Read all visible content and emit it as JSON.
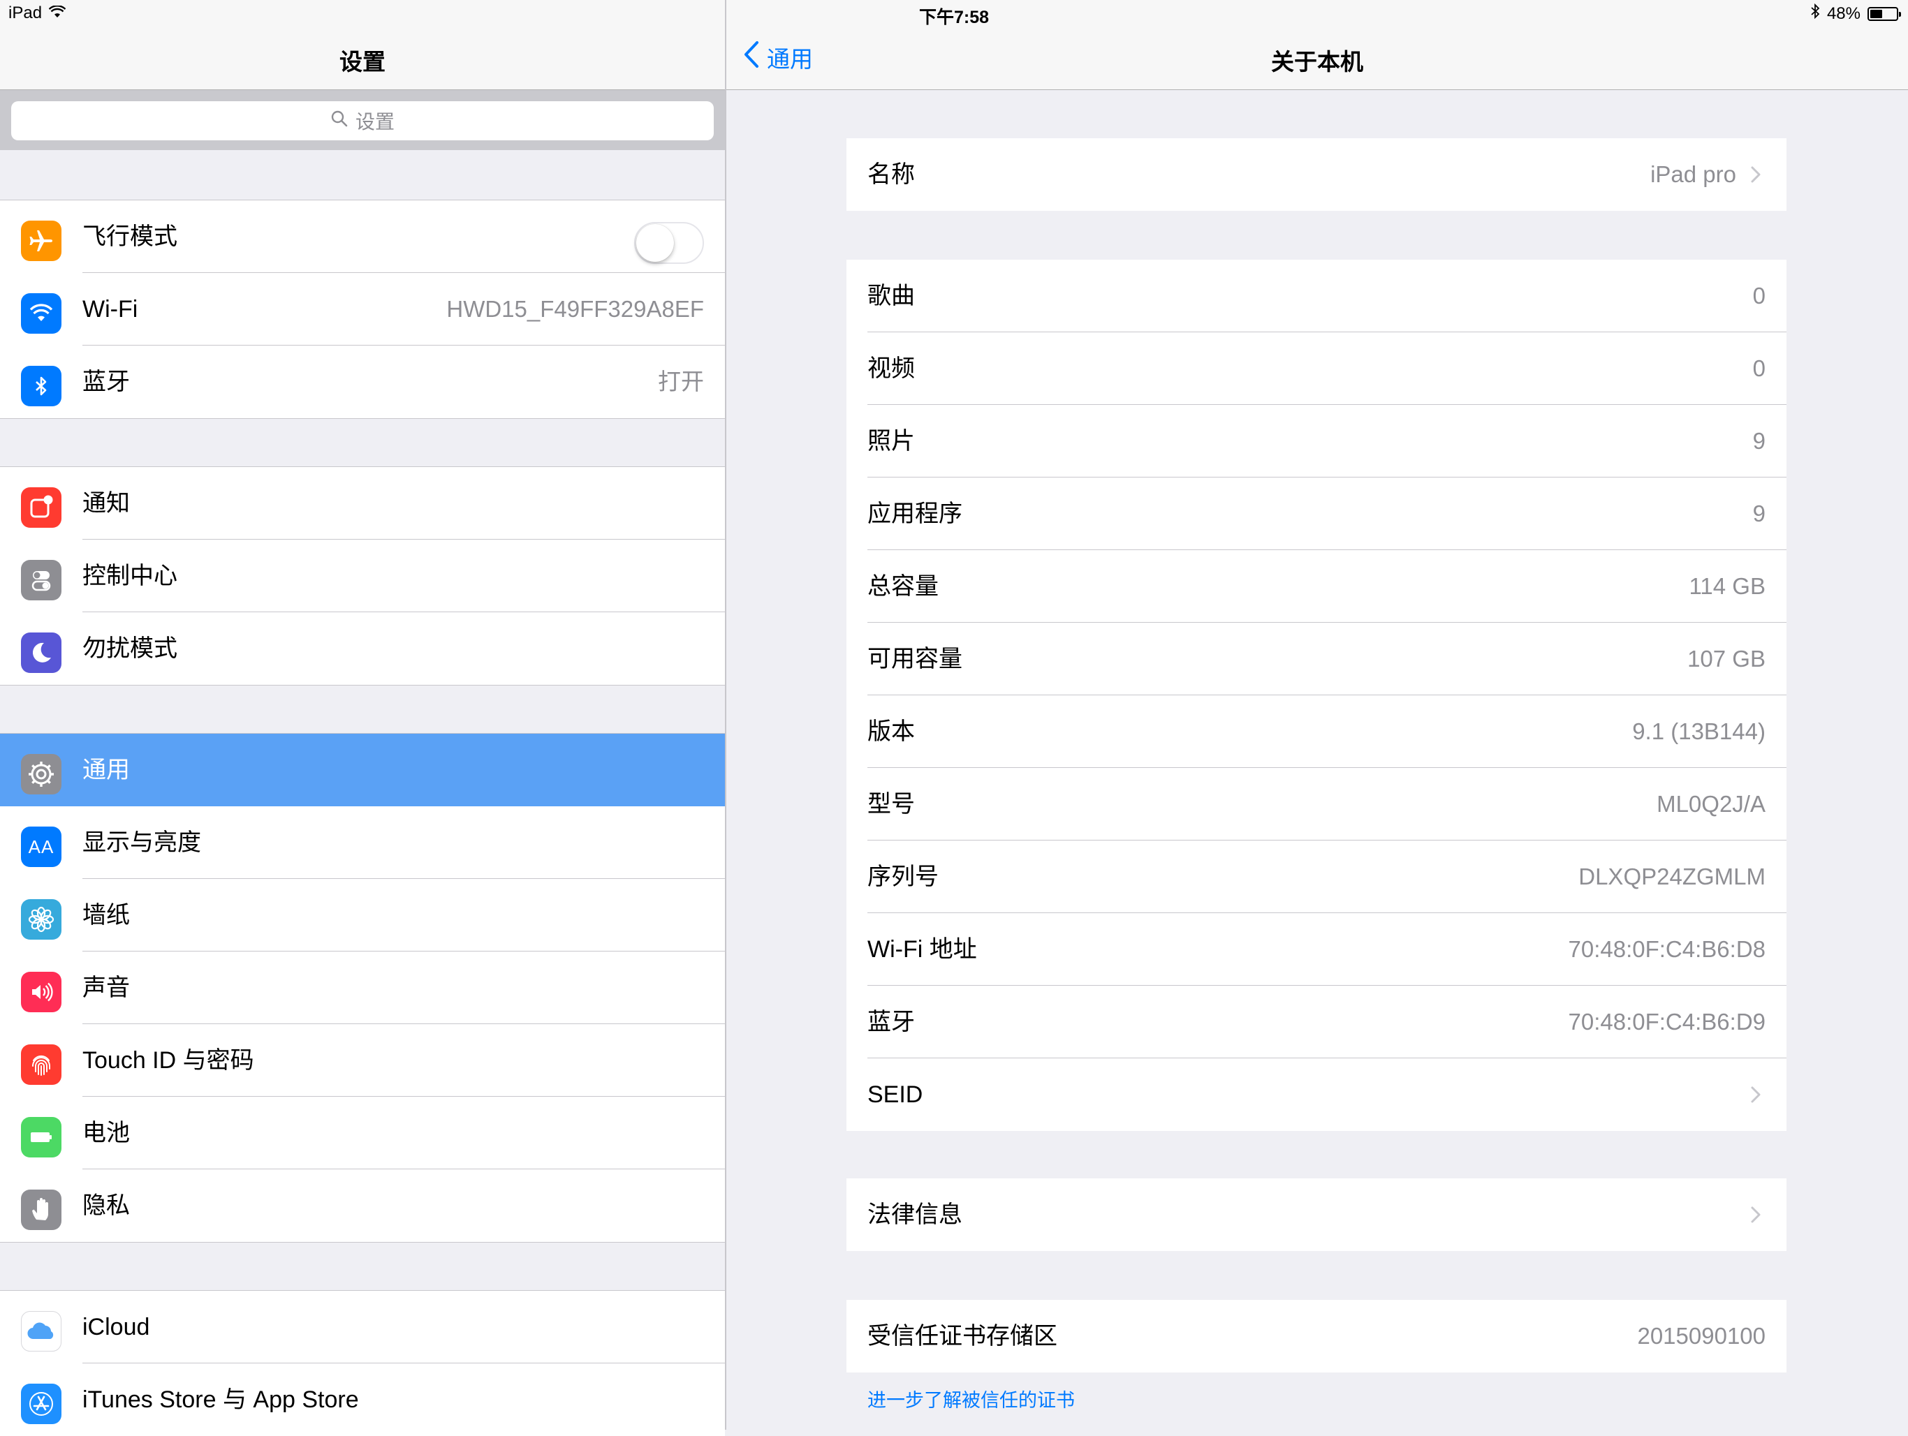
{
  "status_bar": {
    "device": "iPad",
    "time": "下午7:58",
    "battery": "48%",
    "battery_level": 0.48,
    "icons": [
      "wifi-icon",
      "bluetooth-icon",
      "battery-icon"
    ]
  },
  "sidebar": {
    "title": "设置",
    "search_placeholder": "设置",
    "groups": [
      {
        "items": [
          {
            "label": "飞行模式",
            "icon": "airplane-icon",
            "color": "#ff9500",
            "toggle": false
          },
          {
            "label": "Wi-Fi",
            "icon": "wifi-icon",
            "color": "#007aff",
            "value": "HWD15_F49FF329A8EF"
          },
          {
            "label": "蓝牙",
            "icon": "bluetooth-icon",
            "color": "#007aff",
            "value": "打开"
          }
        ]
      },
      {
        "items": [
          {
            "label": "通知",
            "icon": "notifications-icon",
            "color": "#ff3b30"
          },
          {
            "label": "控制中心",
            "icon": "control-center-icon",
            "color": "#8e8e93"
          },
          {
            "label": "勿扰模式",
            "icon": "moon-icon",
            "color": "#5856d6"
          }
        ]
      },
      {
        "items": [
          {
            "label": "通用",
            "icon": "gear-icon",
            "color": "#8e8e93",
            "selected": true
          },
          {
            "label": "显示与亮度",
            "icon": "display-icon",
            "color": "#007aff",
            "icon_text": "AA"
          },
          {
            "label": "墙纸",
            "icon": "wallpaper-icon",
            "color": "#36aadc"
          },
          {
            "label": "声音",
            "icon": "speaker-icon",
            "color": "#ff2d55"
          },
          {
            "label": "Touch ID 与密码",
            "icon": "fingerprint-icon",
            "color": "#ff3b30"
          },
          {
            "label": "电池",
            "icon": "battery-icon",
            "color": "#4cd964"
          },
          {
            "label": "隐私",
            "icon": "hand-icon",
            "color": "#8e8e93"
          }
        ]
      },
      {
        "items": [
          {
            "label": "iCloud",
            "icon": "icloud-icon",
            "color": "#ffffff"
          },
          {
            "label": "iTunes Store 与 App Store",
            "icon": "app-store-icon",
            "color": "#1e90ff"
          }
        ]
      }
    ]
  },
  "detail": {
    "back_label": "通用",
    "title": "关于本机",
    "groups": [
      {
        "rows": [
          {
            "label": "名称",
            "value": "iPad pro",
            "chevron": true
          }
        ]
      },
      {
        "rows": [
          {
            "label": "歌曲",
            "value": "0"
          },
          {
            "label": "视频",
            "value": "0"
          },
          {
            "label": "照片",
            "value": "9"
          },
          {
            "label": "应用程序",
            "value": "9"
          },
          {
            "label": "总容量",
            "value": "114 GB"
          },
          {
            "label": "可用容量",
            "value": "107 GB"
          },
          {
            "label": "版本",
            "value": "9.1 (13B144)"
          },
          {
            "label": "型号",
            "value": "ML0Q2J/A"
          },
          {
            "label": "序列号",
            "value": "DLXQP24ZGMLM"
          },
          {
            "label": "Wi-Fi 地址",
            "value": "70:48:0F:C4:B6:D8"
          },
          {
            "label": "蓝牙",
            "value": "70:48:0F:C4:B6:D9"
          },
          {
            "label": "SEID",
            "value": "",
            "chevron": true
          }
        ]
      },
      {
        "rows": [
          {
            "label": "法律信息",
            "value": "",
            "chevron": true
          }
        ]
      },
      {
        "rows": [
          {
            "label": "受信任证书存储区",
            "value": "2015090100"
          }
        ]
      }
    ],
    "footer_link": "进一步了解被信任的证书"
  }
}
